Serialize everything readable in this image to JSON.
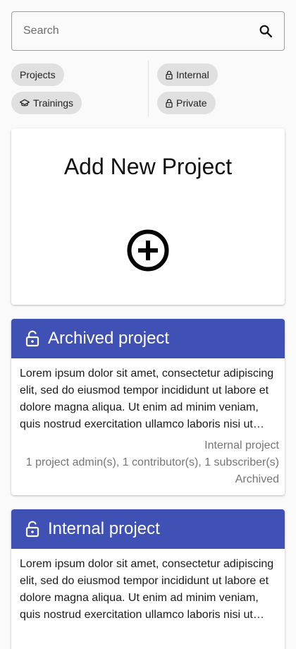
{
  "search": {
    "placeholder": "Search",
    "icon": "search-icon"
  },
  "filters": {
    "left": [
      {
        "label": "Projects",
        "icon": null
      },
      {
        "label": "Trainings",
        "icon": "graduation-cap-icon"
      }
    ],
    "right": [
      {
        "label": "Internal",
        "icon": "lock-icon"
      },
      {
        "label": "Private",
        "icon": "lock-icon"
      }
    ]
  },
  "add_card": {
    "title": "Add New Project",
    "icon": "add-circle-icon"
  },
  "projects": [
    {
      "title": "Archived project",
      "icon": "lock-open-icon",
      "description": "Lorem ipsum dolor sit amet, consectetur adipiscing elit, sed do eiusmod tempor incididunt ut labore et dolore magna aliqua. Ut enim ad minim veniam, quis nostrud exercitation ullamco laboris nisi ut aliquip ex ea commodo consequat.",
      "visibility": "Internal project",
      "members": "1 project admin(s), 1 contributor(s), 1 subscriber(s)",
      "status": "Archived"
    },
    {
      "title": "Internal project",
      "icon": "lock-open-icon",
      "description": "Lorem ipsum dolor sit amet, consectetur adipiscing elit, sed do eiusmod tempor incididunt ut labore et dolore magna aliqua. Ut enim ad minim veniam, quis nostrud exercitation ullamco laboris nisi ut aliquip ex ea commodo consequat."
    }
  ],
  "colors": {
    "header": "#3f51b5",
    "chip": "#e0e0e0",
    "background": "#fafafa",
    "meta_text": "#757575"
  }
}
